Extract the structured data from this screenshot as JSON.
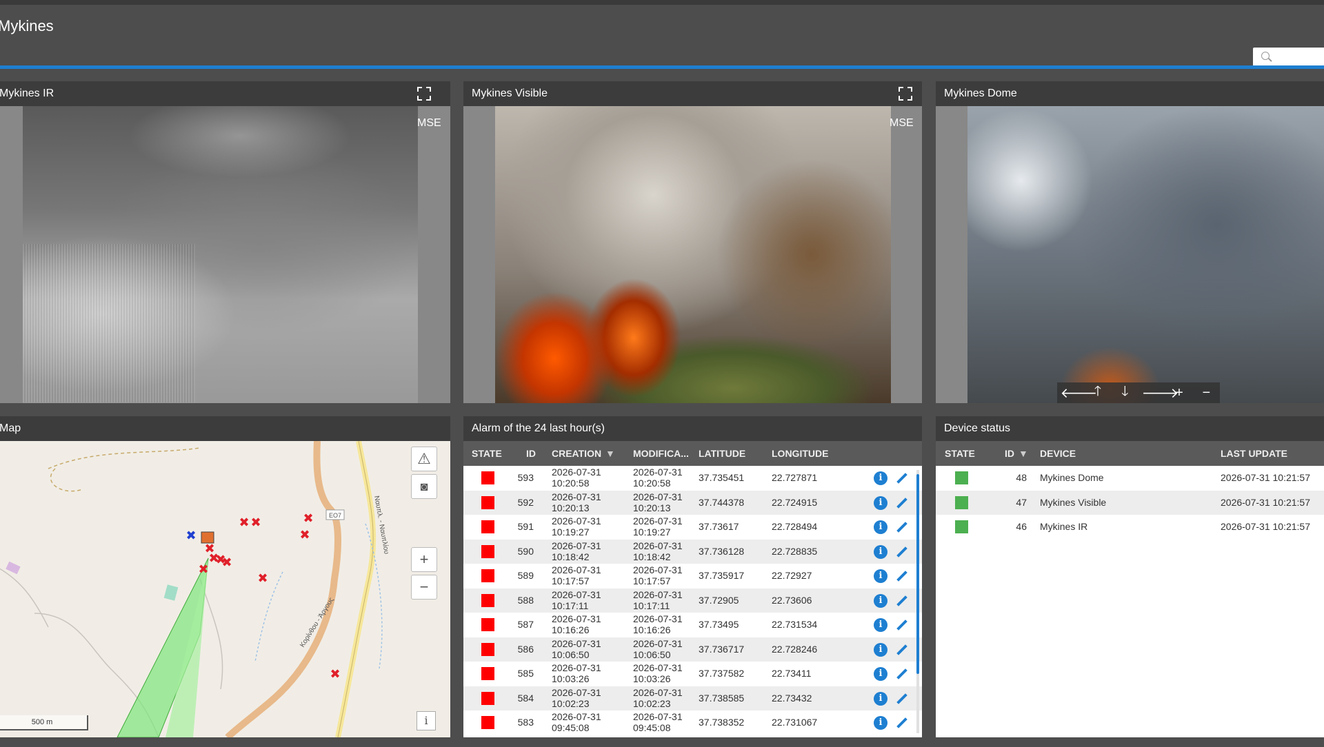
{
  "app": {
    "title": "Mykines"
  },
  "search": {
    "placeholder": ""
  },
  "cameras": [
    {
      "title": "Mykines IR",
      "overlay": "MSE"
    },
    {
      "title": "Mykines Visible",
      "overlay": "MSE"
    },
    {
      "title": "Mykines Dome"
    }
  ],
  "ptz": {
    "left": "🡐",
    "up": "🡑",
    "down": "🡓",
    "right": "🡒",
    "zoom_in": "+",
    "zoom_out": "−"
  },
  "map": {
    "title": "Map",
    "road_label": "ΕΟ7",
    "street_label_1": "Ναυπλ. - Ναυπλίου",
    "street_label_2": "Κορίνθου - Άργους",
    "scale": "500 m",
    "info": "i",
    "zoom_in": "+",
    "zoom_out": "−",
    "icons": [
      "warning-icon",
      "camera-icon"
    ]
  },
  "alarms": {
    "title": "Alarm of the 24 last hour(s)",
    "columns": [
      "STATE",
      "ID",
      "CREATION",
      "MODIFICA...",
      "LATITUDE",
      "LONGITUDE"
    ],
    "state_color": "#ff0000",
    "rows": [
      {
        "id": "593",
        "c_date": "2026-07-31",
        "c_time": "10:20:58",
        "m_date": "2026-07-31",
        "m_time": "10:20:58",
        "lat": "37.735451",
        "lon": "22.727871"
      },
      {
        "id": "592",
        "c_date": "2026-07-31",
        "c_time": "10:20:13",
        "m_date": "2026-07-31",
        "m_time": "10:20:13",
        "lat": "37.744378",
        "lon": "22.724915"
      },
      {
        "id": "591",
        "c_date": "2026-07-31",
        "c_time": "10:19:27",
        "m_date": "2026-07-31",
        "m_time": "10:19:27",
        "lat": "37.73617",
        "lon": "22.728494"
      },
      {
        "id": "590",
        "c_date": "2026-07-31",
        "c_time": "10:18:42",
        "m_date": "2026-07-31",
        "m_time": "10:18:42",
        "lat": "37.736128",
        "lon": "22.728835"
      },
      {
        "id": "589",
        "c_date": "2026-07-31",
        "c_time": "10:17:57",
        "m_date": "2026-07-31",
        "m_time": "10:17:57",
        "lat": "37.735917",
        "lon": "22.72927"
      },
      {
        "id": "588",
        "c_date": "2026-07-31",
        "c_time": "10:17:11",
        "m_date": "2026-07-31",
        "m_time": "10:17:11",
        "lat": "37.72905",
        "lon": "22.73606"
      },
      {
        "id": "587",
        "c_date": "2026-07-31",
        "c_time": "10:16:26",
        "m_date": "2026-07-31",
        "m_time": "10:16:26",
        "lat": "37.73495",
        "lon": "22.731534"
      },
      {
        "id": "586",
        "c_date": "2026-07-31",
        "c_time": "10:06:50",
        "m_date": "2026-07-31",
        "m_time": "10:06:50",
        "lat": "37.736717",
        "lon": "22.728246"
      },
      {
        "id": "585",
        "c_date": "2026-07-31",
        "c_time": "10:03:26",
        "m_date": "2026-07-31",
        "m_time": "10:03:26",
        "lat": "37.737582",
        "lon": "22.73411"
      },
      {
        "id": "584",
        "c_date": "2026-07-31",
        "c_time": "10:02:23",
        "m_date": "2026-07-31",
        "m_time": "10:02:23",
        "lat": "37.738585",
        "lon": "22.73432"
      },
      {
        "id": "583",
        "c_date": "2026-07-31",
        "c_time": "09:45:08",
        "m_date": "2026-07-31",
        "m_time": "09:45:08",
        "lat": "37.738352",
        "lon": "22.731067"
      }
    ]
  },
  "devices": {
    "title": "Device status",
    "columns": [
      "STATE",
      "ID",
      "DEVICE",
      "LAST UPDATE"
    ],
    "state_color": "#4caf50",
    "rows": [
      {
        "id": "48",
        "device": "Mykines Dome",
        "last_update": "2026-07-31 10:21:57"
      },
      {
        "id": "47",
        "device": "Mykines Visible",
        "last_update": "2026-07-31 10:21:57"
      },
      {
        "id": "46",
        "device": "Mykines IR",
        "last_update": "2026-07-31 10:21:57"
      }
    ]
  }
}
